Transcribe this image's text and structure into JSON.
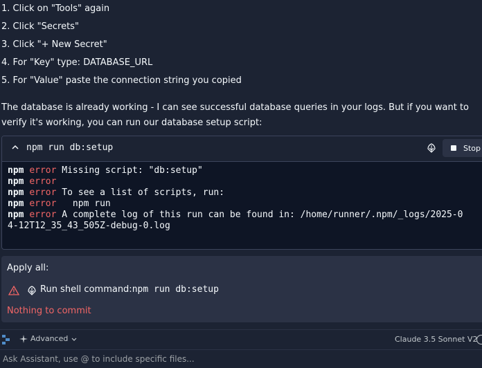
{
  "steps": [
    "1. Click on \"Tools\" again",
    "2. Click \"Secrets\"",
    "3. Click \"+ New Secret\"",
    "4. For \"Key\" type: DATABASE_URL",
    "5. For \"Value\" paste the connection string you copied"
  ],
  "paragraph": "The database is already working - I can see successful database queries in your logs. But if you want to verify it's working, you can run our database setup script:",
  "terminal": {
    "command": "npm run db:setup",
    "stop_label": "Stop",
    "lines": [
      {
        "prefix": "npm",
        "level": "error",
        "text": " Missing script: \"db:setup\""
      },
      {
        "prefix": "npm",
        "level": "error",
        "text": ""
      },
      {
        "prefix": "npm",
        "level": "error",
        "text": " To see a list of scripts, run:"
      },
      {
        "prefix": "npm",
        "level": "error",
        "text": "   npm run"
      },
      {
        "prefix": "npm",
        "level": "error",
        "text": " A complete log of this run can be found in: /home/runner/.npm/_logs/2025-0"
      }
    ],
    "wrap_line": "4-12T12_35_43_505Z-debug-0.log"
  },
  "apply": {
    "title": "Apply all:",
    "action_label": "Run shell command:",
    "action_command": "npm run db:setup",
    "status": "Nothing to commit"
  },
  "toolbar": {
    "mode_label": "Advanced",
    "model_label": "Claude 3.5 Sonnet V2"
  },
  "input": {
    "placeholder": "Ask Assistant, use @ to include specific files..."
  },
  "colors": {
    "background": "#1c2333",
    "terminal_bg": "#0e1525",
    "card_bg": "#2b3245",
    "error": "#f26666",
    "text": "#f5f9fc"
  },
  "icons": {
    "collapse": "chevron-up-icon",
    "shell": "shell-icon",
    "stop": "stop-square-icon",
    "warning": "warning-triangle-icon",
    "logo": "replit-logo-icon",
    "sparkle": "sparkle-icon",
    "dropdown": "chevron-down-icon"
  }
}
